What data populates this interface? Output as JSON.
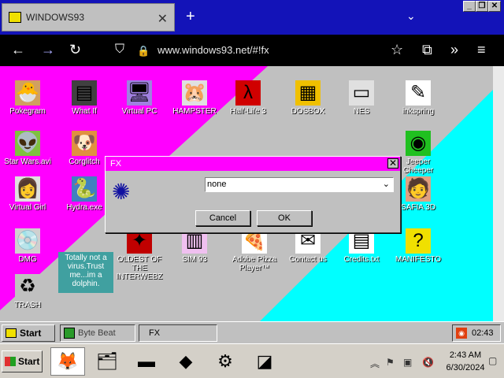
{
  "browser": {
    "tab_title": "WINDOWS93",
    "tab_close": "✕",
    "new_tab": "+",
    "tab_list": "⌄",
    "url": "www.windows93.net/#!fx",
    "window_controls": {
      "minimize": "_",
      "maximize": "❐",
      "close": "✕"
    },
    "nav": {
      "back": "←",
      "forward": "→",
      "reload": "↻",
      "shield": "⛉",
      "lock": "🔒",
      "star": "☆",
      "extensions": "⧉",
      "more": "»",
      "menu": "≡"
    }
  },
  "desktop": {
    "colors": {
      "magenta": "#ff00ff",
      "cyan": "#00ffff",
      "gray": "#c0c0c0"
    },
    "icons": [
      {
        "label": "Pokegram",
        "glyph": "🐣",
        "bg": "#d0a060"
      },
      {
        "label": "What If",
        "glyph": "▤",
        "bg": "#404040"
      },
      {
        "label": "Virtual PC",
        "glyph": "🖥",
        "bg": "#a080e0"
      },
      {
        "label": "HAMPSTER",
        "glyph": "🐹",
        "bg": "#e0e0e0"
      },
      {
        "label": "Half-Life 3",
        "glyph": "λ",
        "bg": "#d00000"
      },
      {
        "label": "DOSBOX",
        "glyph": "▦",
        "bg": "#f0c000"
      },
      {
        "label": "NES",
        "glyph": "▭",
        "bg": "#e0e0e0"
      },
      {
        "label": "inkspring",
        "glyph": "✎",
        "bg": "#ffffff"
      },
      {
        "label": "Star Wars.avi",
        "glyph": "👽",
        "bg": "#80c040"
      },
      {
        "label": "Corglitch",
        "glyph": "🐶",
        "bg": "#e09040"
      },
      {
        "label": "Virtual Girl",
        "glyph": "👩",
        "bg": "#e0e0e0"
      },
      {
        "label": "Hydra.exe",
        "glyph": "🐍",
        "bg": "#4080c0"
      },
      {
        "label": "DMG",
        "glyph": "💿",
        "bg": "#d0d0d0"
      },
      {
        "label": "OLDEST OF THE INTERWEBZ",
        "glyph": "✦",
        "bg": "#c00000"
      },
      {
        "label": "SIM 93",
        "glyph": "▥",
        "bg": "#f0c0f0"
      },
      {
        "label": "Adobe Pizza Player™",
        "glyph": "🍕",
        "bg": "#ffffff"
      },
      {
        "label": "Contact us",
        "glyph": "✉",
        "bg": "#ffffff"
      },
      {
        "label": "Credits.txt",
        "glyph": "▤",
        "bg": "#ffffff"
      },
      {
        "label": "MANIFESTO",
        "glyph": "?",
        "bg": "#f0e000"
      },
      {
        "label": "TRASH",
        "glyph": "♻",
        "bg": "#c0c0c0"
      },
      {
        "label": "SAFIA 3D",
        "glyph": "🧑",
        "bg": "#e0a080"
      },
      {
        "label": "Jeeper Cheeper",
        "glyph": "◉",
        "bg": "#20c020"
      }
    ],
    "sticky_note": "Totally not a virus.Trust me...im a dolphin."
  },
  "dialog": {
    "title": "FX",
    "close": "✕",
    "icon": "✺",
    "select_value": "none",
    "select_arrow": "⌄",
    "cancel": "Cancel",
    "ok": "OK"
  },
  "taskbar93": {
    "start": "Start",
    "tasks": [
      "Byte Beat",
      "FX"
    ],
    "time": "02:43"
  },
  "taskbar7": {
    "start": "Start",
    "apps": [
      {
        "name": "firefox",
        "glyph": "🦊"
      },
      {
        "name": "explorer",
        "glyph": "🗂"
      },
      {
        "name": "cmd",
        "glyph": "▬"
      },
      {
        "name": "app-red",
        "glyph": "◆"
      },
      {
        "name": "control-panel",
        "glyph": "⚙"
      },
      {
        "name": "app-misc",
        "glyph": "◪"
      }
    ],
    "tray": {
      "chevron": "︽",
      "flag": "⚑",
      "network": "▣",
      "volume": "🔇"
    },
    "time": "2:43 AM",
    "date": "6/30/2024"
  }
}
